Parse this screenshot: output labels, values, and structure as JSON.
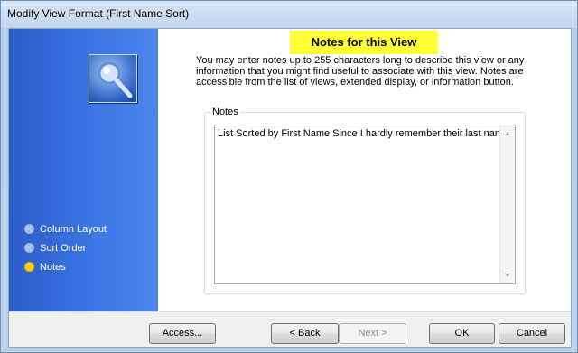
{
  "window": {
    "title": "Modify View Format (First Name Sort)",
    "background_ghost_text": "                   "
  },
  "sidebar": {
    "items": [
      {
        "label": "Column Layout",
        "active": false
      },
      {
        "label": "Sort Order",
        "active": false
      },
      {
        "label": "Notes",
        "active": true
      }
    ]
  },
  "main": {
    "heading": "Notes for this View",
    "description": "You may enter notes up to 255 characters long to describe this view or any information that you might find useful to associate with this view.  Notes are accessible from the list of views, extended display, or information button.",
    "notes_group_label": "Notes",
    "notes_value": "List Sorted by First Name Since I hardly remember their last names"
  },
  "footer": {
    "access_label": "Access...",
    "back_label": "< Back",
    "next_label": "Next >",
    "ok_label": "OK",
    "cancel_label": "Cancel"
  },
  "colors": {
    "heading_bg": "#ffff33",
    "sidebar_blue": "#3b75e2",
    "active_dot": "#ffd21a"
  }
}
